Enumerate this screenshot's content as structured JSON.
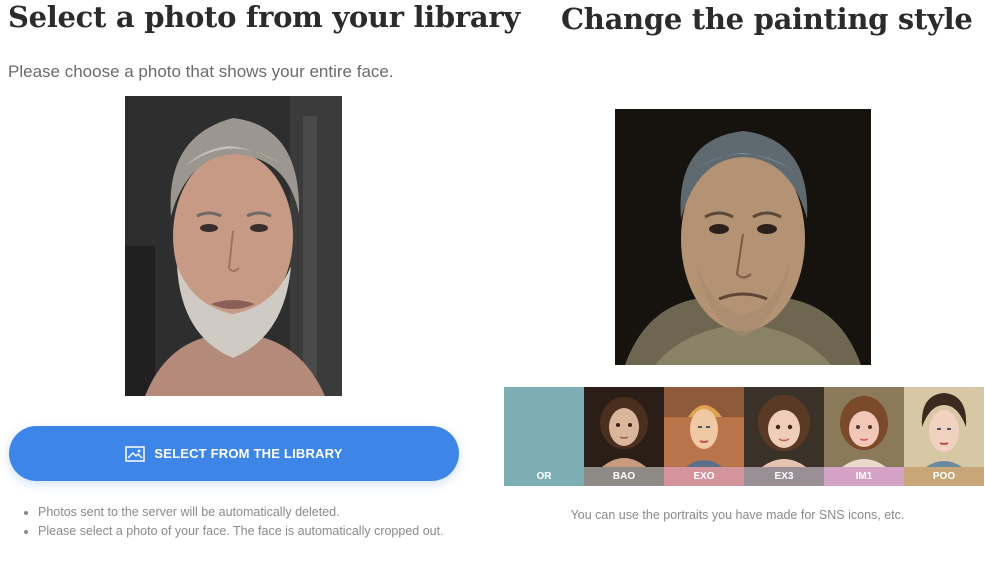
{
  "left": {
    "title": "Select a photo from your library",
    "subtitle": "Please choose a photo that shows your entire face.",
    "button_label": "SELECT FROM THE LIBRARY",
    "notes": [
      "Photos sent to the server will be automatically deleted.",
      "Please select a photo of your face. The face is automatically cropped out."
    ]
  },
  "right": {
    "title": "Change the painting style",
    "styles": [
      {
        "label": "OR",
        "color": "#7daeb4"
      },
      {
        "label": "BAO",
        "color": "#8e8a86"
      },
      {
        "label": "EXO",
        "color": "#d3949b"
      },
      {
        "label": "EX3",
        "color": "#9b8f96"
      },
      {
        "label": "IM1",
        "color": "#d4a2c4"
      },
      {
        "label": "POO",
        "color": "#c9a677"
      }
    ],
    "hint": "You can use the portraits you have made for SNS icons, etc."
  },
  "colors": {
    "accent": "#3d86e8"
  }
}
